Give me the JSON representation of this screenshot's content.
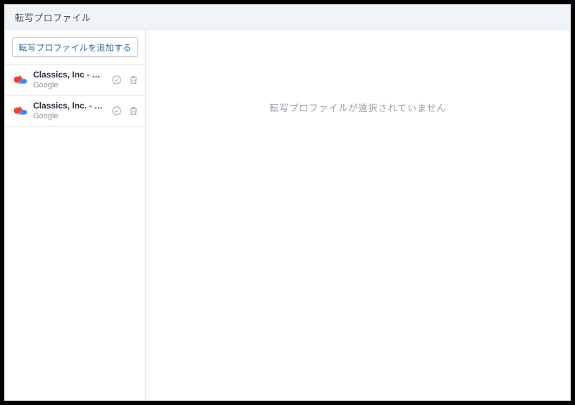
{
  "header": {
    "title": "転写プロファイル"
  },
  "sidebar": {
    "addButtonLabel": "転写プロファイルを追加する",
    "items": [
      {
        "title": "Classics, Inc - Spa...",
        "subtitle": "Google",
        "provider": "google-cloud"
      },
      {
        "title": "Classics, Inc. - En...",
        "subtitle": "Google",
        "provider": "google-cloud"
      }
    ]
  },
  "main": {
    "emptyMessage": "転写プロファイルが選択されていません"
  }
}
